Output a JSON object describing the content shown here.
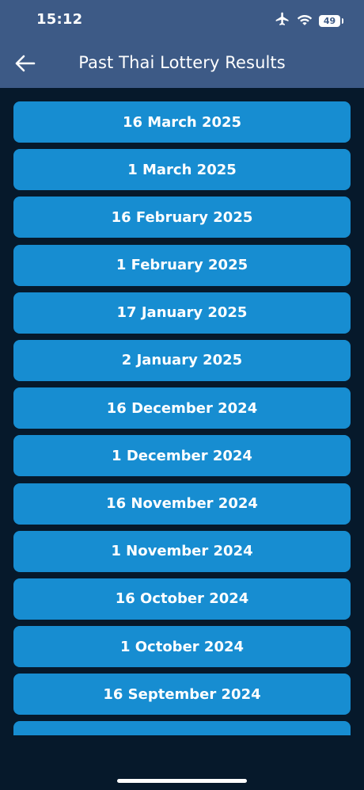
{
  "status": {
    "time": "15:12",
    "battery": "49",
    "icons": [
      "airplane-icon",
      "wifi-icon",
      "battery-icon"
    ]
  },
  "header": {
    "title": "Past Thai Lottery Results",
    "back_icon": "arrow-left-icon"
  },
  "dates": [
    "16 March 2025",
    "1 March 2025",
    "16 February 2025",
    "1 February 2025",
    "17 January 2025",
    "2 January 2025",
    "16 December 2024",
    "1 December 2024",
    "16 November 2024",
    "1 November 2024",
    "16 October 2024",
    "1 October 2024",
    "16 September 2024",
    ""
  ],
  "colors": {
    "header": "#3d5a86",
    "background": "#06192b",
    "button": "#178dd1",
    "text": "#ffffff"
  }
}
